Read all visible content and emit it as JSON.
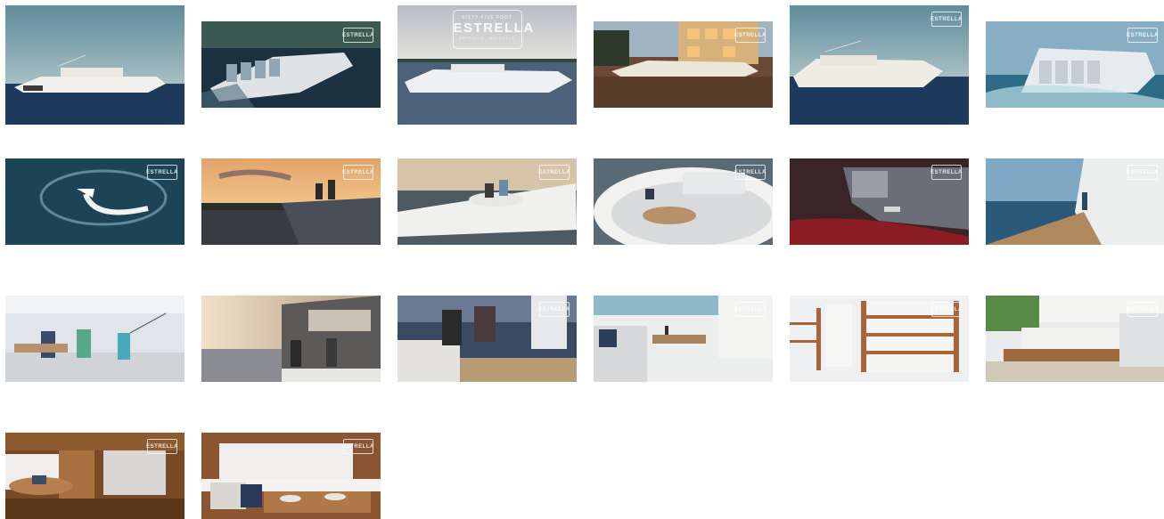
{
  "brand": {
    "badge_text": "ESTRELLA",
    "hero_top": "SIXTY-FIVE FOOT",
    "hero_bottom": "ESTRELLA · VALHALLA"
  },
  "gallery": {
    "thumbnails": [
      {
        "subject": "boat-cruising"
      },
      {
        "subject": "boat-night-engines"
      },
      {
        "subject": "boat-hero-logo"
      },
      {
        "subject": "boat-docked-house"
      },
      {
        "subject": "boat-cruising-2"
      },
      {
        "subject": "boat-stern-engines"
      },
      {
        "subject": "boat-aerial-wake"
      },
      {
        "subject": "couple-sunset-bow"
      },
      {
        "subject": "couple-bow-lounge"
      },
      {
        "subject": "bow-seating"
      },
      {
        "subject": "engines-red-light"
      },
      {
        "subject": "side-deck-walkway"
      },
      {
        "subject": "friends-fishing-cockpit"
      },
      {
        "subject": "cockpit-sunset"
      },
      {
        "subject": "couple-dining-evening"
      },
      {
        "subject": "cockpit-dining-table"
      },
      {
        "subject": "teak-seat-backs"
      },
      {
        "subject": "aft-lounge-teak"
      },
      {
        "subject": "cabin-galley"
      },
      {
        "subject": "cabin-dinette"
      }
    ]
  }
}
